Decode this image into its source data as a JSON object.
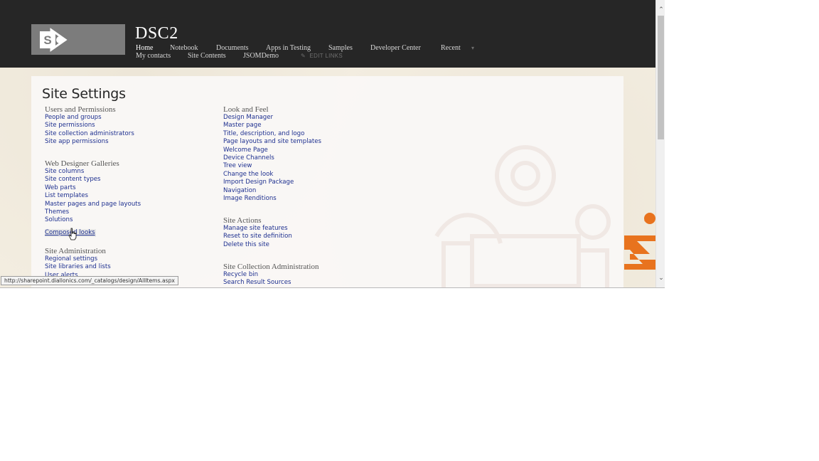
{
  "site": {
    "title": "DSC2",
    "logo_letter": "S"
  },
  "nav": {
    "row1": [
      {
        "label": "Home",
        "active": true
      },
      {
        "label": "Notebook"
      },
      {
        "label": "Documents"
      },
      {
        "label": "Apps in Testing"
      },
      {
        "label": "Samples"
      },
      {
        "label": "Developer Center"
      },
      {
        "label": "Recent"
      }
    ],
    "row2": [
      {
        "label": "My contacts"
      },
      {
        "label": "Site Contents"
      },
      {
        "label": "JSOMDemo"
      }
    ],
    "edit_links": "EDIT LINKS"
  },
  "page": {
    "title": "Site Settings"
  },
  "sections": {
    "users": {
      "heading": "Users and Permissions",
      "links": [
        "People and groups",
        "Site permissions",
        "Site collection administrators",
        "Site app permissions"
      ]
    },
    "galleries": {
      "heading": "Web Designer Galleries",
      "links": [
        "Site columns",
        "Site content types",
        "Web parts",
        "List templates",
        "Master pages and page layouts",
        "Themes",
        "Solutions",
        "Composed looks"
      ]
    },
    "admin": {
      "heading": "Site Administration",
      "links": [
        "Regional settings",
        "Site libraries and lists",
        "User alerts"
      ]
    },
    "look": {
      "heading": "Look and Feel",
      "links": [
        "Design Manager",
        "Master page",
        "Title, description, and logo",
        "Page layouts and site templates",
        "Welcome Page",
        "Device Channels",
        "Tree view",
        "Change the look",
        "Import Design Package",
        "Navigation",
        "Image Renditions"
      ]
    },
    "actions": {
      "heading": "Site Actions",
      "links": [
        "Manage site features",
        "Reset to site definition",
        "Delete this site"
      ]
    },
    "collection": {
      "heading": "Site Collection Administration",
      "links": [
        "Recycle bin",
        "Search Result Sources"
      ]
    }
  },
  "status_bar": {
    "url": "http://sharepoint.diallonics.com/_catalogs/design/AllItems.aspx"
  },
  "colors": {
    "link": "#1d2f8f",
    "suitebar": "#262626",
    "accent": "#e8731e"
  }
}
